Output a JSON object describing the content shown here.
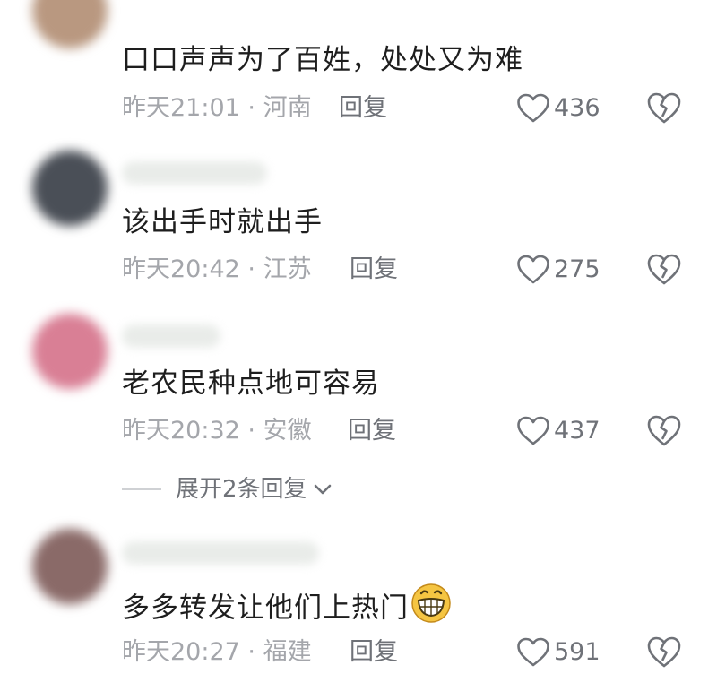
{
  "comments": [
    {
      "text": "口口声声为了百姓，处处又为难",
      "time": "昨天21:01",
      "location": "河南",
      "reply_label": "回复",
      "likes": "436",
      "avatar_color": "#b99880"
    },
    {
      "text": "该出手时就出手",
      "time": "昨天20:42",
      "location": "江苏",
      "reply_label": "回复",
      "likes": "275",
      "avatar_color": "#4a4f57"
    },
    {
      "text": "老农民种点地可容易",
      "time": "昨天20:32",
      "location": "安徽",
      "reply_label": "回复",
      "likes": "437",
      "avatar_color": "#d97f95"
    },
    {
      "text": "多多转发让他们上热门",
      "time": "昨天20:27",
      "location": "福建",
      "reply_label": "回复",
      "likes": "591",
      "avatar_color": "#8a6a68",
      "emoji": "grinning-face-icon"
    }
  ],
  "expand_replies": {
    "label": "展开2条回复",
    "icon": "chevron-down-icon"
  },
  "separator": "·",
  "colors": {
    "text": "#1e1e1e",
    "meta": "#a4a6ab",
    "action": "#6f7278",
    "emoji": "#f5c542"
  }
}
